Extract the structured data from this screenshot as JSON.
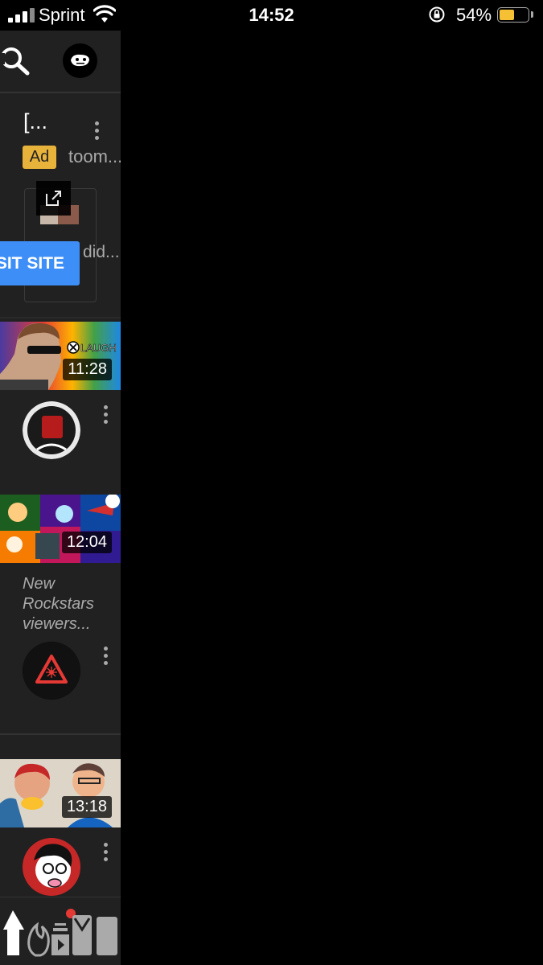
{
  "status_bar": {
    "carrier": "Sprint",
    "time": "14:52",
    "battery_pct": "54%",
    "battery_level": 0.54,
    "battery_color": "#f5c033"
  },
  "header": {
    "search_icon": "search-icon",
    "account_icon": "avatar"
  },
  "ad": {
    "title": "[...",
    "badge": "Ad",
    "domain": "toom...",
    "description": "did...",
    "cta_label": "SIT SITE",
    "cta_color": "#3e8ef7",
    "badge_color": "#e8b33a"
  },
  "videos": [
    {
      "duration": "11:28",
      "thumb_text": "LAUGH"
    },
    {
      "duration": "12:04",
      "title_lines": [
        "New",
        "Rockstars",
        "viewers..."
      ]
    },
    {
      "duration": "13:18"
    }
  ],
  "bottom_nav": {
    "icons": [
      "home-icon",
      "trending-icon",
      "subscriptions-icon",
      "inbox-icon",
      "library-icon"
    ]
  }
}
